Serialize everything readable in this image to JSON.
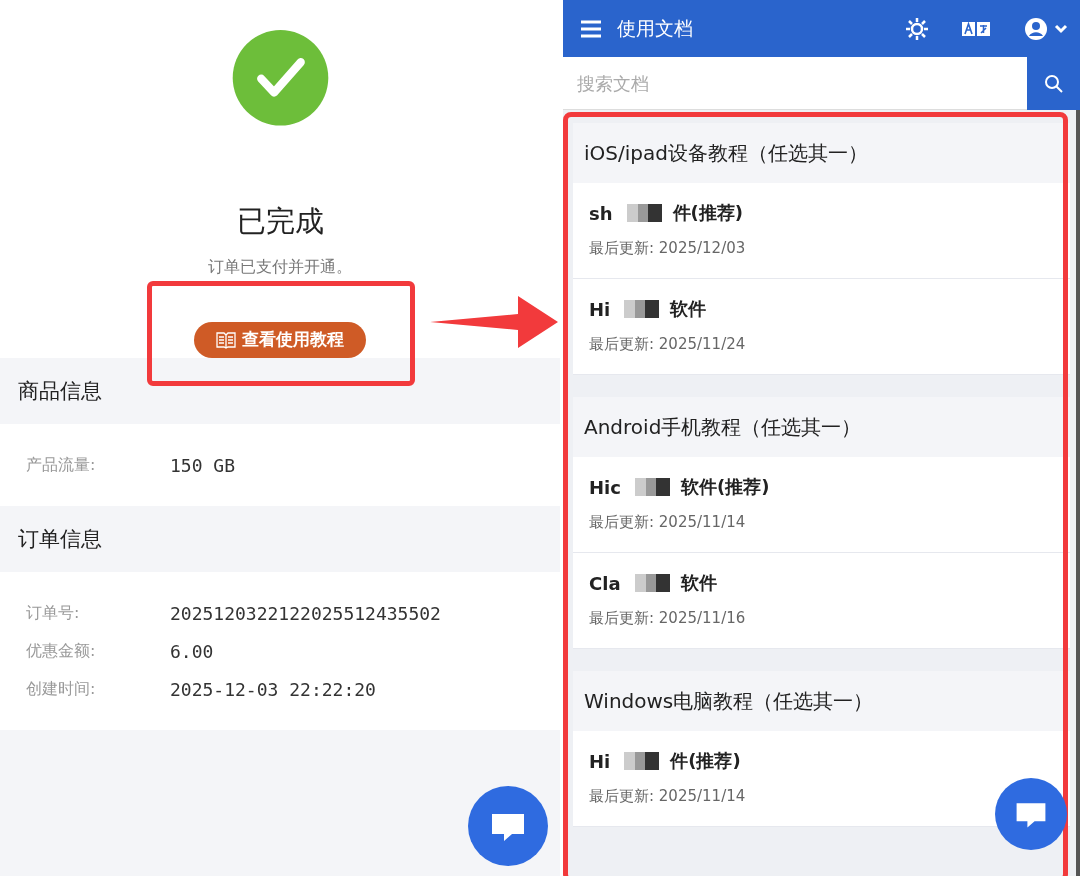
{
  "order": {
    "status_title": "已完成",
    "status_message": "订单已支付并开通。",
    "tutorial_button": "查看使用教程",
    "sections": [
      {
        "title": "商品信息",
        "fields": [
          {
            "label": "产品流量:",
            "value": "150 GB"
          }
        ]
      },
      {
        "title": "订单信息",
        "fields": [
          {
            "label": "订单号:",
            "value": "2025120322122025512435502"
          },
          {
            "label": "优惠金额:",
            "value": "6.00"
          },
          {
            "label": "创建时间:",
            "value": "2025-12-03 22:22:20"
          }
        ]
      }
    ]
  },
  "docs": {
    "title": "使用文档",
    "search": {
      "placeholder": "搜索文档"
    },
    "groups": [
      {
        "title": "iOS/ipad设备教程（任选其一）",
        "items": [
          {
            "title_start": "sh",
            "title_end": "件(推荐)",
            "updated": "最后更新: 2025/12/03"
          },
          {
            "title_start": "Hi",
            "title_end": "软件",
            "updated": "最后更新: 2025/11/24"
          }
        ]
      },
      {
        "title": "Android手机教程（任选其一）",
        "items": [
          {
            "title_start": "Hic",
            "title_end": "软件(推荐)",
            "updated": "最后更新: 2025/11/14"
          },
          {
            "title_start": "Cla",
            "title_end": "软件",
            "updated": "最后更新: 2025/11/16"
          }
        ]
      },
      {
        "title": "Windows电脑教程（任选其一）",
        "items": [
          {
            "title_start": "Hi",
            "title_end": "件(推荐)",
            "updated": "最后更新: 2025/11/14"
          }
        ]
      }
    ]
  }
}
